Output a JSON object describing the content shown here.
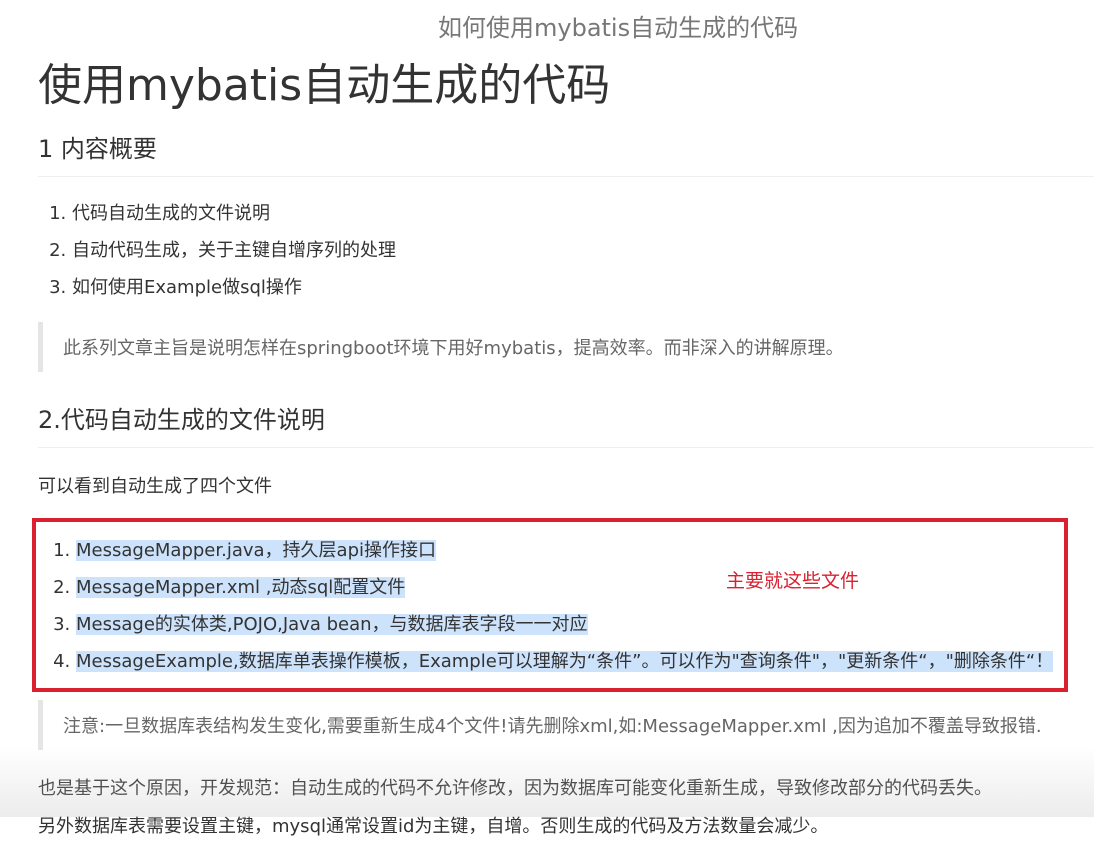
{
  "page_title": "如何使用mybatis自动生成的代码",
  "article": {
    "heading": "使用mybatis自动生成的代码",
    "section1": {
      "title": "1 内容概要",
      "items": [
        "代码自动生成的文件说明",
        "自动代码生成，关于主键自增序列的处理",
        "如何使用Example做sql操作"
      ],
      "quote": "此系列文章主旨是说明怎样在springboot环境下用好mybatis，提高效率。而非深入的讲解原理。"
    },
    "section2": {
      "title": "2.代码自动生成的文件说明",
      "intro": "可以看到自动生成了四个文件",
      "files": [
        "MessageMapper.java，持久层api操作接口",
        "MessageMapper.xml ,动态sql配置文件",
        "Message的实体类,POJO,Java bean，与数据库表字段一一对应",
        "MessageExample,数据库单表操作模板，Example可以理解为“条件”。可以作为\"查询条件\"，\"更新条件“，\"删除条件“！"
      ],
      "annotation": "主要就这些文件",
      "note": "注意:一旦数据库表结构发生变化,需要重新生成4个文件!请先删除xml,如:MessageMapper.xml ,因为追加不覆盖导致报错.",
      "paragraphs": [
        "也是基于这个原因，开发规范：自动生成的代码不允许修改，因为数据库可能变化重新生成，导致修改部分的代码丢失。",
        "另外数据库表需要设置主键，mysql通常设置id为主键，自增。否则生成的代码及方法数量会减少。"
      ]
    }
  },
  "colors": {
    "annotation_red": "#d92130",
    "highlight_blue": "#cde3fb",
    "quote_border": "#e5e5e5"
  }
}
